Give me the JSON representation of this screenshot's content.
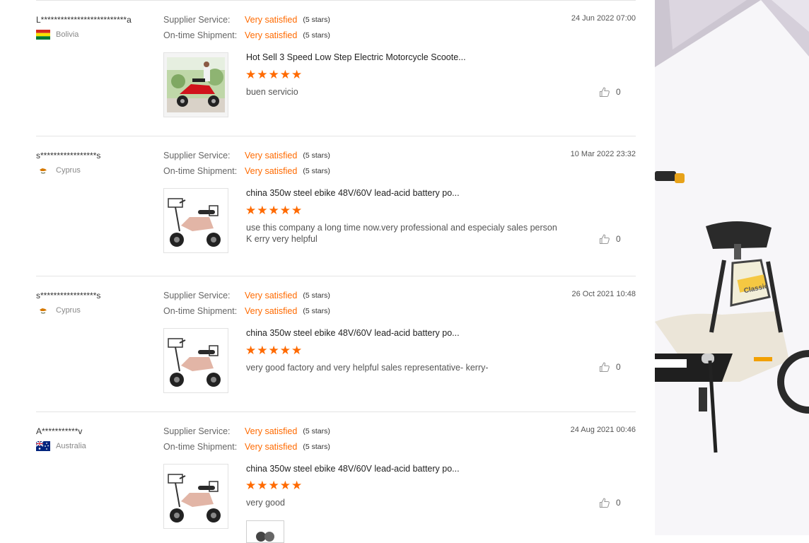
{
  "rating_labels": {
    "supplier": "Supplier Service:",
    "shipment": "On-time Shipment:"
  },
  "colors": {
    "accent": "#ff6a00",
    "divider": "#e4e4e4"
  },
  "reviews": [
    {
      "reviewer": "L**************************a",
      "country": "Bolivia",
      "flag": "bolivia-flag-icon",
      "supplier_rating": "Very satisfied",
      "supplier_stars": "(5 stars)",
      "shipment_rating": "Very satisfied",
      "shipment_stars": "(5 stars)",
      "date": "24 Jun 2022 07:00",
      "product_title": "Hot Sell 3 Speed Low Step Electric Motorcycle Scoote...",
      "stars": 5,
      "comment": "buen servicio",
      "likes": "0"
    },
    {
      "reviewer": "s*****************s",
      "country": "Cyprus",
      "flag": "cyprus-flag-icon",
      "supplier_rating": "Very satisfied",
      "supplier_stars": "(5 stars)",
      "shipment_rating": "Very satisfied",
      "shipment_stars": "(5 stars)",
      "date": "10 Mar 2022 23:32",
      "product_title": "china 350w steel ebike 48V/60V lead-acid battery po...",
      "stars": 5,
      "comment": "use this company a long time now.very professional and especialy sales person K erry very helpful",
      "likes": "0"
    },
    {
      "reviewer": "s*****************s",
      "country": "Cyprus",
      "flag": "cyprus-flag-icon",
      "supplier_rating": "Very satisfied",
      "supplier_stars": "(5 stars)",
      "shipment_rating": "Very satisfied",
      "shipment_stars": "(5 stars)",
      "date": "26 Oct 2021 10:48",
      "product_title": "china 350w steel ebike 48V/60V lead-acid battery po...",
      "stars": 5,
      "comment": "very good factory and very helpful sales representative- kerry-",
      "likes": "0"
    },
    {
      "reviewer": "A***********v",
      "country": "Australia",
      "flag": "australia-flag-icon",
      "supplier_rating": "Very satisfied",
      "supplier_stars": "(5 stars)",
      "shipment_rating": "Very satisfied",
      "shipment_stars": "(5 stars)",
      "date": "24 Aug 2021 00:46",
      "product_title": "china 350w steel ebike 48V/60V lead-acid battery po...",
      "stars": 5,
      "comment": "very good",
      "likes": "0"
    }
  ],
  "side_banner": {
    "brand_label": "Classic"
  }
}
